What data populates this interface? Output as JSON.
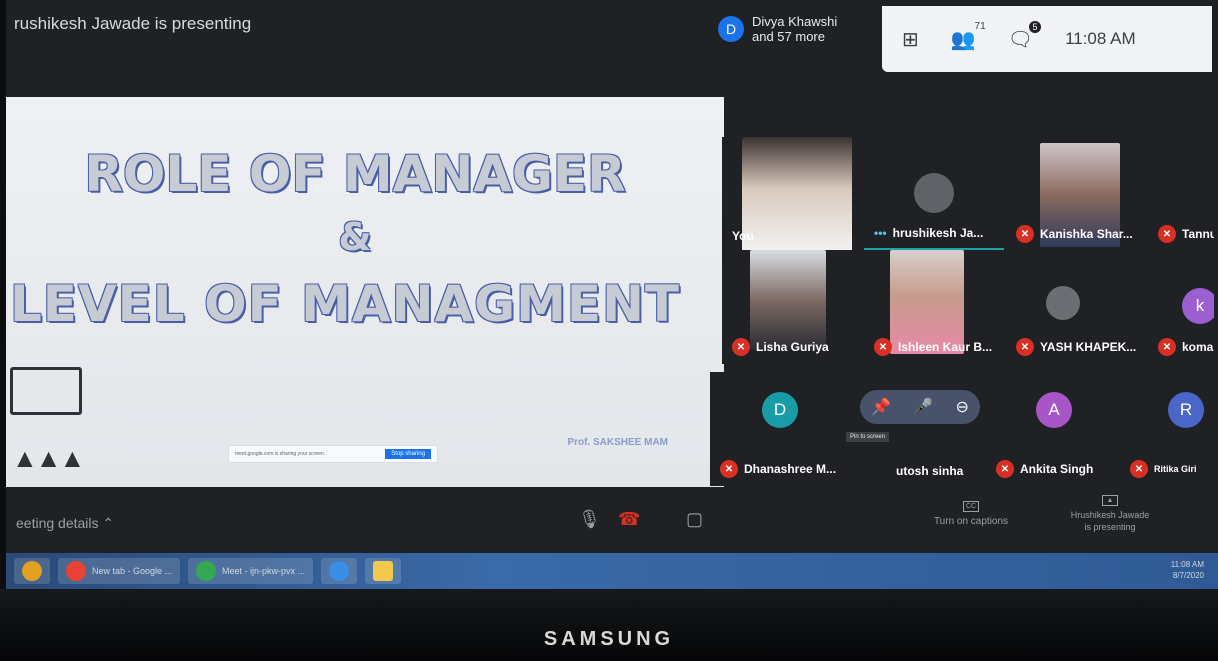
{
  "topbar": {
    "presenter_text": "rushikesh Jawade is presenting",
    "participants_avatar": "D",
    "participants_line1": "Divya Khawshi",
    "participants_line2": "and 57 more",
    "people_count": "71",
    "chat_count": "5",
    "clock": "11:08 AM",
    "icons": [
      "grid-layout-icon",
      "people-icon",
      "chat-icon"
    ]
  },
  "slide": {
    "title1": "ROLE OF MANAGER",
    "amp": "&",
    "title2": "LEVEL OF MANAGMENT",
    "professor": "Prof. SAKSHEE MAM",
    "share_msg": "meet.google.com is sharing your screen.",
    "stop_share": "Stop sharing"
  },
  "tiles": [
    {
      "name": "You"
    },
    {
      "name": "hrushikesh Ja..."
    },
    {
      "name": "Kanishka Shar..."
    },
    {
      "name": "Tannu"
    },
    {
      "name": "Lisha Guriya"
    },
    {
      "name": "Ishleen Kaur B..."
    },
    {
      "name": "YASH KHAPEK..."
    },
    {
      "name": "komal bi",
      "letter": "k"
    },
    {
      "name": "Dhanashree M...",
      "letter": "D"
    },
    {
      "name": "utosh sinha"
    },
    {
      "name": "Ankita Singh",
      "letter": "A"
    },
    {
      "name": "Ritika Giri",
      "letter": "R"
    }
  ],
  "tile_controls": {
    "tooltip": "Pin to screen"
  },
  "bottombar": {
    "meeting_details": "eeting details",
    "captions": "Turn on captions",
    "present_line1": "Hrushikesh Jawade",
    "present_line2": "is presenting"
  },
  "taskbar": {
    "items": [
      "New tab - Google ...",
      "Meet - ijn-pkw-pvx ..."
    ],
    "tray_time": "11:08 AM",
    "tray_date": "8/7/2020"
  },
  "bezel": {
    "brand": "SAMSUNG"
  },
  "colors": {
    "accent": "#1a73e8",
    "mute": "#d93025",
    "panel": "#f1f3f4"
  }
}
